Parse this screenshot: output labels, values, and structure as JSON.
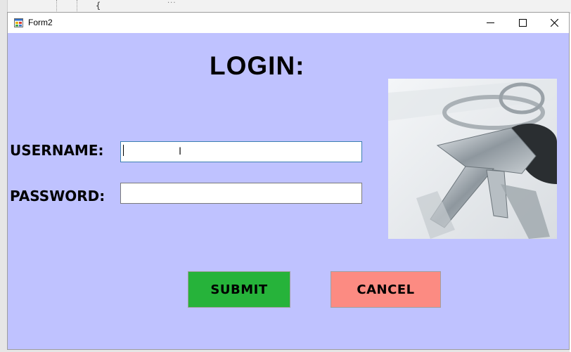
{
  "window": {
    "title": "Form2",
    "icon": "form-app-icon",
    "controls": [
      "minimize-icon",
      "maximize-icon",
      "close-icon"
    ]
  },
  "form": {
    "heading": "LOGIN:",
    "username_label": "USERNAME:",
    "username_value": "",
    "password_label": "PASSWORD:",
    "password_value": "",
    "image": "keys-photo",
    "submit_label": "SUBMIT",
    "cancel_label": "CANCEL"
  },
  "background_code": {
    "brace": "{",
    "dots": "..."
  },
  "colors": {
    "form_background": "#bfc2ff",
    "submit_button": "#26b33a",
    "cancel_button": "#fc8b82",
    "focused_border": "#3c7fb1"
  }
}
